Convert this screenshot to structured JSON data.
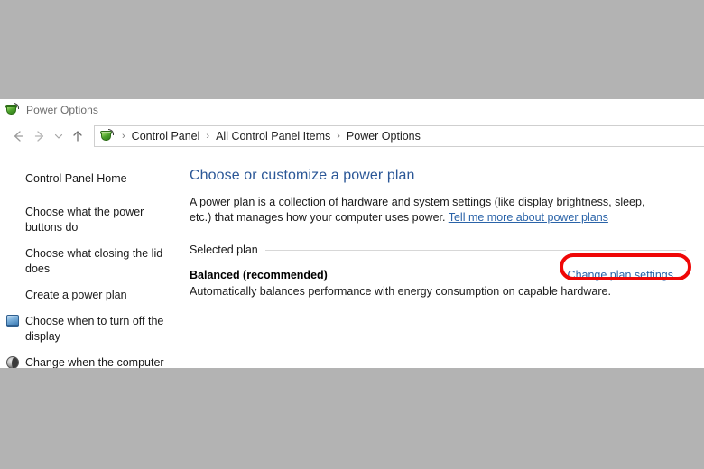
{
  "window": {
    "title": "Power Options",
    "app_icon": "power-plug-icon"
  },
  "nav": {
    "back_icon": "back-arrow-icon",
    "forward_icon": "forward-arrow-icon",
    "recent_icon": "chevron-down-icon",
    "up_icon": "up-arrow-icon",
    "breadcrumb": {
      "icon": "power-plug-icon",
      "separator": "›",
      "items": [
        "Control Panel",
        "All Control Panel Items",
        "Power Options"
      ]
    }
  },
  "sidebar": {
    "items": [
      {
        "label": "Control Panel Home",
        "icon": ""
      },
      {
        "label": "Choose what the power buttons do",
        "icon": ""
      },
      {
        "label": "Choose what closing the lid does",
        "icon": ""
      },
      {
        "label": "Create a power plan",
        "icon": ""
      },
      {
        "label": "Choose when to turn off the display",
        "icon": "monitor-icon"
      },
      {
        "label": "Change when the computer sleeps",
        "icon": "sleep-moon-icon"
      }
    ]
  },
  "main": {
    "heading": "Choose or customize a power plan",
    "description_part1": "A power plan is a collection of hardware and system settings (like display brightness, sleep, etc.) that manages how your computer uses power. ",
    "description_link": "Tell me more about power plans",
    "group_label": "Selected plan",
    "plan": {
      "name": "Balanced (recommended)",
      "action_label": "Change plan settings",
      "description": "Automatically balances performance with energy consumption on capable hardware."
    }
  },
  "annotation": {
    "shape": "oval-highlight",
    "color": "#ef0707",
    "targets": "Change plan settings"
  },
  "colors": {
    "desktop_gray": "#b3b3b3",
    "window_background": "#ffffff",
    "heading_blue": "#2b5797",
    "link_blue": "#2a63a8",
    "text_dark": "#1a1a1a",
    "title_gray": "#6d6d6d",
    "annotation_red": "#ef0707"
  }
}
